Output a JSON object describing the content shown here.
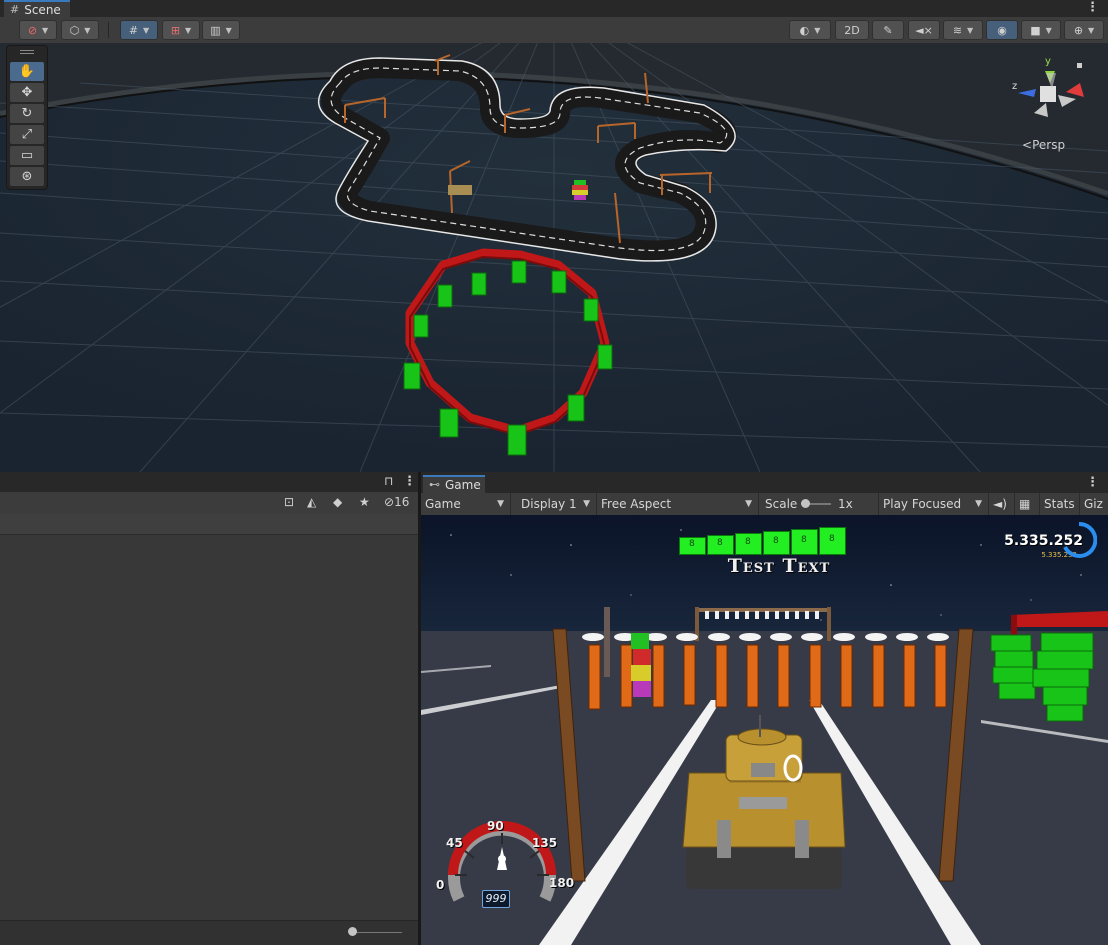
{
  "scene": {
    "tab_label": "Scene",
    "tab_icon": "#",
    "toolbar": {
      "mode_2d_label": "2D"
    },
    "tools": [
      "hand-tool",
      "move-tool",
      "rotate-tool",
      "scale-tool",
      "rect-tool",
      "transform-tool"
    ],
    "gizmo": {
      "persp_label": "Persp",
      "axis_z": "z",
      "axis_y": "y"
    }
  },
  "hierarchy": {
    "visibility_count": "16"
  },
  "game": {
    "tab_label": "Game",
    "toolbar": {
      "view_select": "Game",
      "display_select": "Display 1",
      "aspect_select": "Free Aspect",
      "scale_label": "Scale",
      "scale_value": "1x",
      "play_mode_select": "Play Focused",
      "stats_label": "Stats",
      "gizmos_label": "Giz"
    },
    "hud": {
      "title": "Test Text",
      "score": "5.335.252",
      "score_small": "5.335.252",
      "ammo_blocks": [
        "8",
        "8",
        "8",
        "8",
        "8",
        "8"
      ],
      "speedometer": {
        "labels": [
          "0",
          "45",
          "90",
          "135",
          "180"
        ],
        "speed_value": "999"
      }
    }
  },
  "colors": {
    "accent": "#3a79bb",
    "panel": "#383838",
    "toolbar": "#3c3c3c",
    "grass_green": "#18d418",
    "fence_red": "#c01818",
    "hud_green": "#22ee22",
    "post_orange": "#f07010"
  }
}
